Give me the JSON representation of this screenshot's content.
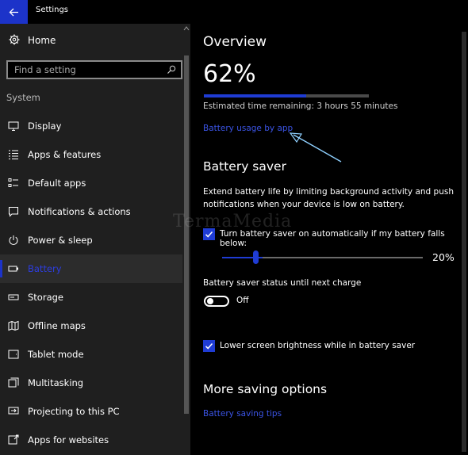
{
  "window": {
    "title": "Settings"
  },
  "sidebar": {
    "home_label": "Home",
    "search_placeholder": "Find a setting",
    "section_title": "System",
    "items": [
      {
        "label": "Display",
        "icon": "monitor-icon"
      },
      {
        "label": "Apps & features",
        "icon": "list-icon"
      },
      {
        "label": "Default apps",
        "icon": "checklist-icon"
      },
      {
        "label": "Notifications & actions",
        "icon": "message-icon"
      },
      {
        "label": "Power & sleep",
        "icon": "power-icon"
      },
      {
        "label": "Battery",
        "icon": "battery-icon",
        "selected": true
      },
      {
        "label": "Storage",
        "icon": "storage-icon"
      },
      {
        "label": "Offline maps",
        "icon": "map-icon"
      },
      {
        "label": "Tablet mode",
        "icon": "tablet-icon"
      },
      {
        "label": "Multitasking",
        "icon": "multitask-icon"
      },
      {
        "label": "Projecting to this PC",
        "icon": "project-icon"
      },
      {
        "label": "Apps for websites",
        "icon": "web-apps-icon"
      }
    ]
  },
  "main": {
    "overview_title": "Overview",
    "battery_percent": "62%",
    "battery_level": 0.62,
    "estimated_time": "Estimated time remaining: 3 hours 55 minutes",
    "usage_link": "Battery usage by app",
    "saver_title": "Battery saver",
    "saver_description": "Extend battery life by limiting background activity and push notifications when your device is low on battery.",
    "auto_saver_label": "Turn battery saver on automatically if my battery falls below:",
    "auto_saver_checked": true,
    "threshold_value": "20%",
    "threshold_level": 0.2,
    "status_label": "Battery saver status until next charge",
    "status_toggle_text": "Off",
    "brightness_label": "Lower screen brightness while in battery saver",
    "brightness_checked": true,
    "more_title": "More saving options",
    "tips_link": "Battery saving tips"
  },
  "watermark": "TermaMedia",
  "colors": {
    "accent": "#1f3cd4",
    "link": "#3b54e6",
    "sidebar_bg": "#1f1f1f",
    "background": "#000000"
  }
}
